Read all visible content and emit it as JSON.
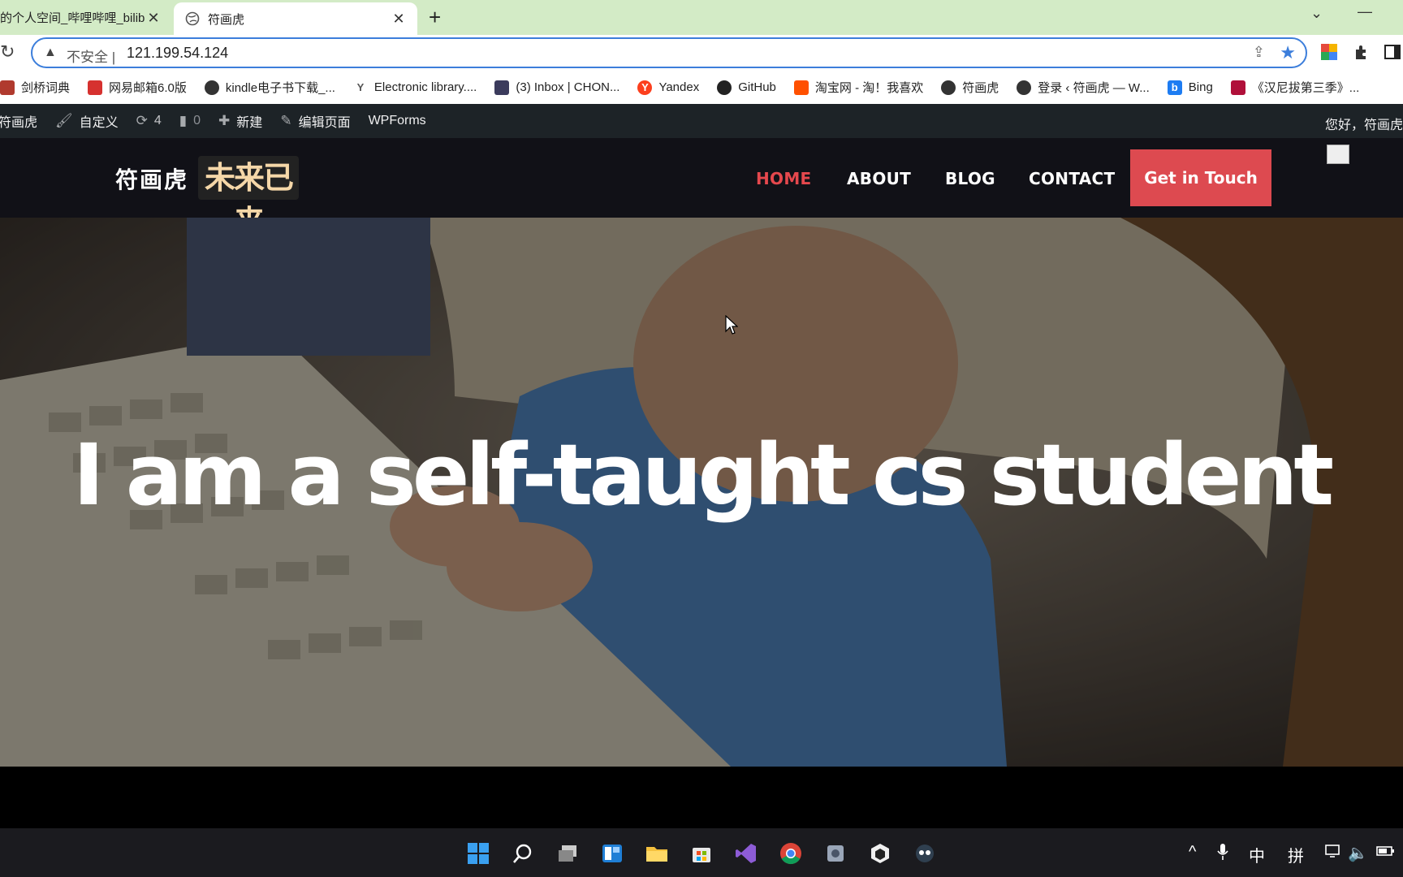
{
  "browser": {
    "tabs": [
      {
        "title": "的个人空间_哔哩哔哩_bilibili",
        "active": false
      },
      {
        "title": "符画虎",
        "active": true
      }
    ],
    "new_tab_symbol": "+",
    "security_label": "不安全",
    "separator": "|",
    "url": "121.199.54.124"
  },
  "bookmarks": [
    {
      "label": "剑桥词典",
      "icon": "cambridge-icon",
      "color": "#b03a2e"
    },
    {
      "label": "网易邮箱6.0版",
      "icon": "netease-mail-icon",
      "color": "#d6312f"
    },
    {
      "label": "kindle电子书下载_...",
      "icon": "globe-icon",
      "color": "#333333"
    },
    {
      "label": "Electronic library....",
      "icon": "y-icon",
      "color": "#555555"
    },
    {
      "label": "(3) Inbox | CHON...",
      "icon": "proton-icon",
      "color": "#3b3b5c"
    },
    {
      "label": "Yandex",
      "icon": "yandex-icon",
      "color": "#fc3f1d"
    },
    {
      "label": "GitHub",
      "icon": "github-icon",
      "color": "#222222"
    },
    {
      "label": "淘宝网 - 淘！我喜欢",
      "icon": "taobao-icon",
      "color": "#ff5000"
    },
    {
      "label": "符画虎",
      "icon": "globe-icon",
      "color": "#333333"
    },
    {
      "label": "登录 ‹ 符画虎 — W...",
      "icon": "globe-icon",
      "color": "#333333"
    },
    {
      "label": "Bing",
      "icon": "bing-icon",
      "color": "#1d7cf2"
    },
    {
      "label": "《汉尼拔第三季》...",
      "icon": "media-icon",
      "color": "#b0103a"
    }
  ],
  "wpbar": {
    "site": "符画虎",
    "customize": "自定义",
    "updates": "4",
    "comments": "0",
    "new": "新建",
    "edit": "编辑页面",
    "wpforms": "WPForms",
    "greeting": "您好，符画虎"
  },
  "site": {
    "logo_text": "符画虎",
    "logo_badge": "未来已来",
    "nav": [
      {
        "label": "HOME",
        "active": true
      },
      {
        "label": "ABOUT",
        "active": false
      },
      {
        "label": "BLOG",
        "active": false
      },
      {
        "label": "CONTACT",
        "active": false
      }
    ],
    "cta_label": "Get in Touch",
    "accent_color": "#dd4a50",
    "header_bg": "#111117"
  },
  "hero": {
    "title": "I am a self-taught cs student"
  },
  "taskbar": {
    "apps": [
      "start-icon",
      "search-icon",
      "task-view-icon",
      "widgets-icon",
      "file-explorer-icon",
      "store-icon",
      "visual-studio-icon",
      "chrome-icon",
      "app-icon",
      "unity-icon",
      "app-icon-2"
    ],
    "tray_ime_1": "中",
    "tray_ime_2": "拼"
  }
}
